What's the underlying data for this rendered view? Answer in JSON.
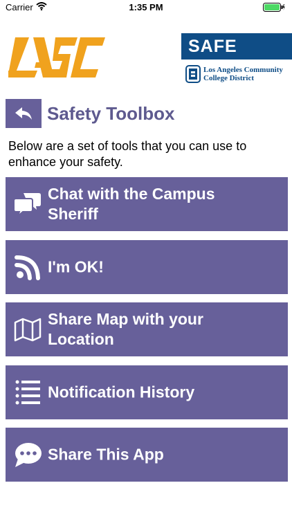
{
  "status_bar": {
    "carrier": "Carrier",
    "time": "1:35 PM"
  },
  "header": {
    "safe_label": "SAFE",
    "district_line1": "Los Angeles Community",
    "district_line2": "College District"
  },
  "page": {
    "title": "Safety Toolbox",
    "intro": "Below are a set of tools that you can use to enhance your safety."
  },
  "tools": [
    {
      "label": "Chat with the Campus Sheriff",
      "icon": "chat-bubbles-icon"
    },
    {
      "label": "I'm OK!",
      "icon": "rss-icon"
    },
    {
      "label": "Share Map with your Location",
      "icon": "map-icon"
    },
    {
      "label": "Notification History",
      "icon": "list-icon"
    },
    {
      "label": "Share This App",
      "icon": "speech-bubble-icon"
    }
  ],
  "colors": {
    "accent": "#67609a",
    "title": "#5e5a8f",
    "safe_blue": "#0f4d86",
    "logo_orange": "#f0a21e"
  }
}
